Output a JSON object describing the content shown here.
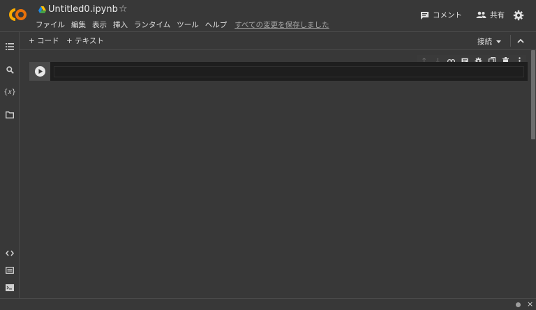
{
  "header": {
    "title": "Untitled0.ipynb",
    "star": "☆",
    "menu": [
      "ファイル",
      "編集",
      "表示",
      "挿入",
      "ランタイム",
      "ツール",
      "ヘルプ"
    ],
    "save_status": "すべての変更を保存しました",
    "comment_label": "コメント",
    "share_label": "共有"
  },
  "toolbar": {
    "add_code": "+ コード",
    "add_text": "+ テキスト",
    "connect": "接続"
  },
  "cell": {
    "code": ""
  },
  "statusbar": {
    "close": "×"
  },
  "colors": {
    "logo_orange": "#F9AB00",
    "logo_dark": "#E8710A",
    "background": "#383838",
    "cell_bg": "#1e1e1e"
  }
}
